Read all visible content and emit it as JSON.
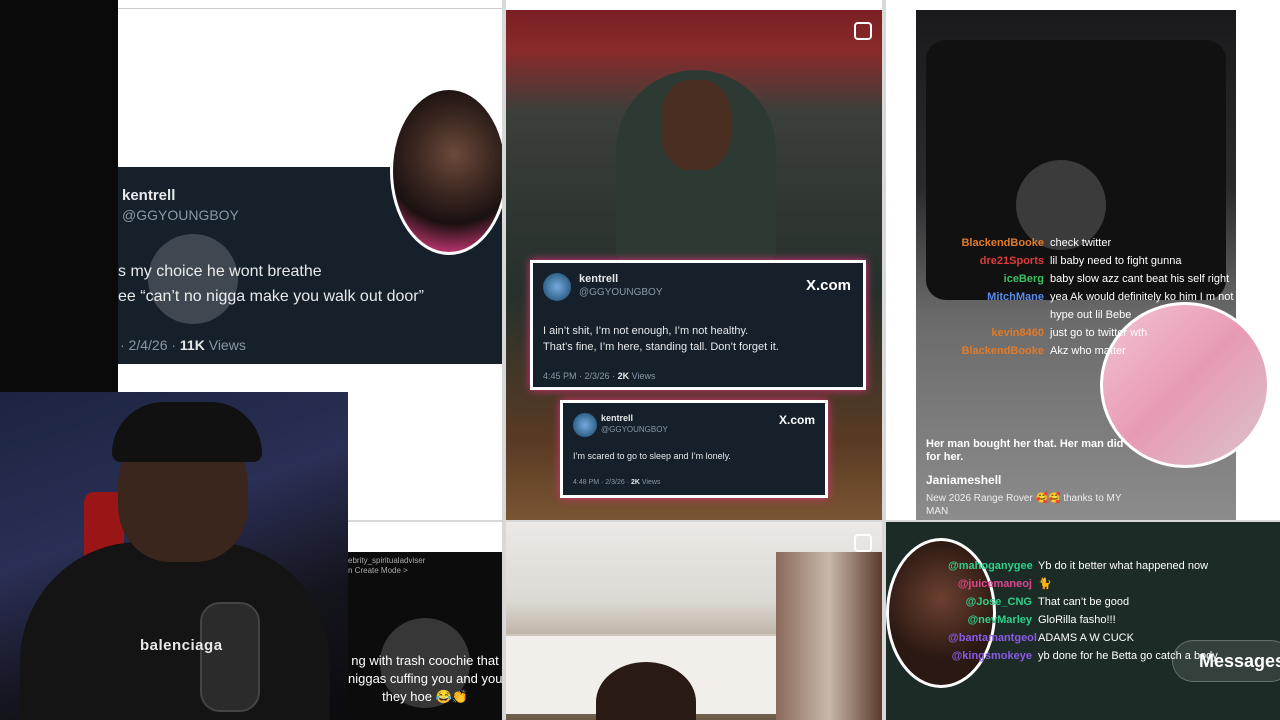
{
  "left_tweet": {
    "name": "kentrell",
    "handle": "@GGYOUNGBOY",
    "body": "s my choice he wont breathe\nee “can’t no nigga make you walk out door”",
    "date": "· 2/4/26 ·",
    "views_count": "11K",
    "views_label": "Views"
  },
  "webcam": {
    "hoodie_text": "balenciaga"
  },
  "left_bottom_post": {
    "header": "ebrity_spiritualadviser\nn Create Mode >",
    "caption": "ng with trash coochie that\nniggas cuffing you and you\nthey hoe 😂👏"
  },
  "center_tweets": [
    {
      "name": "kentrell",
      "handle": "@GGYOUNGBOY",
      "brand": "X.com",
      "body": "I ain’t shit, I’m not enough, I’m not healthy.\nThat’s fine, I’m here, standing tall. Don’t forget it.",
      "meta": "4:45 PM · 2/3/26 ·",
      "views_count": "2K",
      "views_label": "Views"
    },
    {
      "name": "kentrell",
      "handle": "@GGYOUNGBOY",
      "brand": "X.com",
      "body": "I’m scared to go to sleep and I’m lonely.",
      "meta": "4:48 PM · 2/3/26 ·",
      "views_count": "2K",
      "views_label": "Views"
    }
  ],
  "right_post": {
    "caption": "Her man bought her that. Her man did\nfor her.",
    "username": "Janiameshell",
    "caption2": "New 2026 Range Rover 🥰🥰 thanks to MY\nMAN"
  },
  "chat_top": [
    {
      "user": "BlackendBooke",
      "message": "check twitter",
      "color": "#e07b2a"
    },
    {
      "user": "dre21Sports",
      "message": "lil baby need to fight gunna",
      "color": "#e03a3a"
    },
    {
      "user": "iceBerg",
      "message": "baby slow azz cant beat his self right",
      "color": "#3ac060"
    },
    {
      "user": "MitchMane",
      "message": "yea Ak would definitely ko him I m not going to",
      "color": "#5a8ae8"
    },
    {
      "user": "",
      "message": "hype out lil Bebe",
      "color": "#ffffff"
    },
    {
      "user": "kevin8460",
      "message": "just go to twitter wth",
      "color": "#e07b2a"
    },
    {
      "user": "BlackendBooke",
      "message": "Akz who matter",
      "color": "#e07b2a"
    }
  ],
  "chat_bottom": [
    {
      "user": "@mahoganygee",
      "message": "Yb do it better what happened now",
      "color": "#2fd08a"
    },
    {
      "user": "@juicemaneoj",
      "message": "🐈",
      "color": "#e0478c"
    },
    {
      "user": "@Jose_CNG",
      "message": "That can’t be good",
      "color": "#2fd08a"
    },
    {
      "user": "@nevMarley",
      "message": "GloRilla fasho!!!",
      "color": "#2fd08a"
    },
    {
      "user": "@bantamantgeol",
      "message": "ADAMS A W CUCK",
      "color": "#8a5ae8"
    },
    {
      "user": "@kingsmokeye",
      "message": "yb done for he Betta go catch a body",
      "color": "#8a5ae8"
    }
  ],
  "messages_button": "Messages"
}
